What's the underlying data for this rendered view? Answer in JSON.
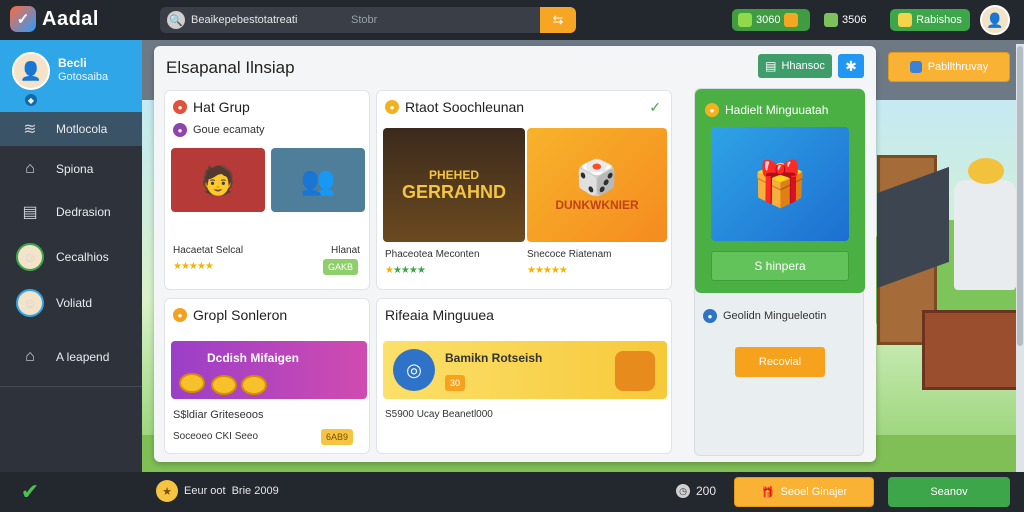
{
  "topbar": {
    "app_title": "Aadal",
    "search_value": "Beaikepebestotatreati",
    "search_hint": "Stobr",
    "coins": "3060",
    "gems": "3506",
    "boost_label": "Rabishos"
  },
  "sidebar": {
    "profile_name": "Becli",
    "profile_sub": "Gotosaiba",
    "items": [
      {
        "label": "Motlocola",
        "icon": "chart-icon"
      },
      {
        "label": "Spiona",
        "icon": "home-icon"
      },
      {
        "label": "Dedrasion",
        "icon": "document-icon"
      },
      {
        "label": "Cecalhios",
        "icon": "avatar-icon"
      },
      {
        "label": "Voliatd",
        "icon": "avatar-icon"
      },
      {
        "label": "A leapend",
        "icon": "home-icon"
      }
    ]
  },
  "panel": {
    "title": "Elsapanal Ilnsiap",
    "primary_button": "Hhansoc",
    "top_right_button": "Pabllthruvay",
    "card1": {
      "title": "Hat Grup",
      "sub": "Goue ecamaty",
      "left_caption": "Hacaetat Selcal",
      "right_caption": "Hlanat",
      "chip": "GAKB"
    },
    "card2": {
      "title": "Rtaot Soochleunan",
      "left_caption": "Phaceotea Meconten",
      "right_caption": "Snecoce Riatenam",
      "poster_line1": "PHEHED",
      "poster_line2": "GERRAHND",
      "poster2_text": "DUNKWKNIER"
    },
    "card3": {
      "title": "Gropl Sonleron",
      "banner_title": "Dcdish Mifaigen",
      "caption": "S$ldiar Griteseoos",
      "sub_caption": "Soceoeo CKI Seeo",
      "chip": "6AB9"
    },
    "card4": {
      "title": "Rifeaia Minguuea",
      "banner_title": "Bamikn Rotseish",
      "banner_chip": "30",
      "caption": "S5900 Ucay Beanetl000"
    }
  },
  "rail": {
    "title": "Hadielt Minguuatah",
    "button": "S hinpera",
    "sub": "Geolidn Mingueleotin",
    "cta": "Recovial"
  },
  "bottombar": {
    "left_text": "Eeur oot",
    "left_text2": "Brie 2009",
    "count": "200",
    "btn1": "Seoel Ginajer",
    "btn2": "Seanov"
  },
  "colors": {
    "accent_green": "#3ea64a",
    "accent_orange": "#f9b233",
    "accent_blue": "#2ea6e8"
  }
}
